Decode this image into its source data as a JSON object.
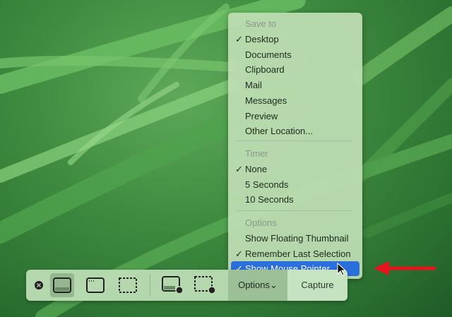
{
  "menu": {
    "save_header": "Save to",
    "save_items": [
      {
        "label": "Desktop",
        "checked": true
      },
      {
        "label": "Documents"
      },
      {
        "label": "Clipboard"
      },
      {
        "label": "Mail"
      },
      {
        "label": "Messages"
      },
      {
        "label": "Preview"
      },
      {
        "label": "Other Location..."
      }
    ],
    "timer_header": "Timer",
    "timer_items": [
      {
        "label": "None",
        "checked": true
      },
      {
        "label": "5 Seconds"
      },
      {
        "label": "10 Seconds"
      }
    ],
    "options_header": "Options",
    "option_items": [
      {
        "label": "Show Floating Thumbnail"
      },
      {
        "label": "Remember Last Selection",
        "checked": true
      },
      {
        "label": "Show Mouse Pointer",
        "checked": true,
        "highlighted": true
      }
    ],
    "check": "✓"
  },
  "toolbar": {
    "options_label": "Options",
    "options_chevron": "⌄",
    "capture_label": "Capture"
  },
  "colors": {
    "highlight": "#2a6fdc",
    "arrow": "#e8141c"
  }
}
